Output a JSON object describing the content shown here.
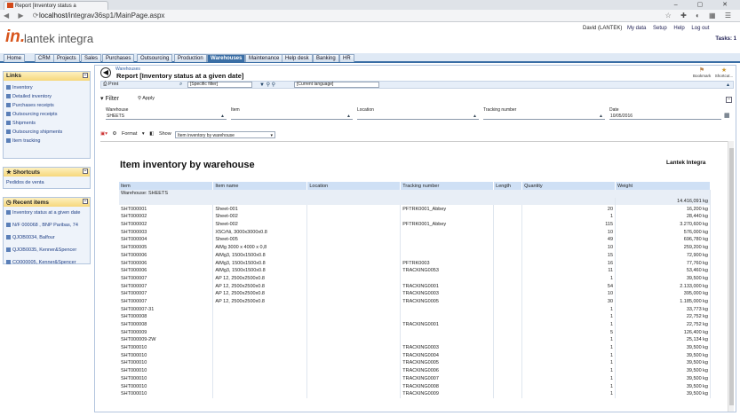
{
  "browser": {
    "tab_title": "Report [Inventory status a",
    "url_host": "localhost",
    "url_path": "/integrav36sp1/MainPage.aspx",
    "nav_glyphs": "◀ ▶ ⟳",
    "url_icons": "☆ ✚ ◐ ▦ ☰"
  },
  "app": {
    "logo_in": "in.",
    "logo_text": "lantek integra",
    "user": "David (LANTEK)",
    "top_links": [
      "My data",
      "Setup",
      "Help",
      "Log out"
    ],
    "tasks": "Tasks: 1"
  },
  "menu": [
    "Home",
    "CRM",
    "Projects",
    "Sales",
    "Purchases",
    "Outsourcing",
    "Production",
    "Warehouses",
    "Maintenance",
    "Help desk",
    "Banking",
    "HR"
  ],
  "menu_active": "Warehouses",
  "sidebar": {
    "links_title": "Links",
    "links": [
      "Inventory",
      "Detailed inventory",
      "Purchases receipts",
      "Outsourcing receipts",
      "Shipments",
      "Outsourcing shipments",
      "Item tracking"
    ],
    "shortcuts_title": "Shortcuts",
    "shortcuts": [
      "Pedidos de venta"
    ],
    "recent_title": "Recent items",
    "recent": [
      "Inventory status at a given date",
      "N/F 000068 , BNP Paribas, 74",
      "QJOB0034, Balfour",
      "QJOB0035, Kenner&Spencer",
      "CO000005, Kenner&Spencer"
    ]
  },
  "page": {
    "breadcrumb": "Warehouses",
    "title": "Report [Inventory status at a given date]",
    "bookmark": "Bookmark",
    "shortcut": "Shortcut...",
    "print": "Print",
    "filter_select": "[Specific filter]",
    "language_select": "[Current language]",
    "filter_label": "Filter",
    "apply_label": "Apply"
  },
  "filters": {
    "warehouse_label": "Warehouse",
    "warehouse_value": "SHEETS",
    "item_label": "Item",
    "item_value": "",
    "location_label": "Location",
    "location_value": "",
    "tracking_label": "Tracking number",
    "tracking_value": "",
    "date_label": "Date",
    "date_value": "10/05/2016"
  },
  "report_tools": {
    "format": "Format",
    "show": "Show",
    "report_select": "Item inventory by warehouse"
  },
  "report": {
    "title": "Item inventory by warehouse",
    "company": "Lantek Integra",
    "columns": [
      "Item",
      "Item name",
      "Location",
      "Tracking number",
      "Length",
      "Quantity",
      "Weight"
    ],
    "warehouse_row": "Warehouse: SHEETS",
    "total_weight": "14.416,091 kg",
    "rows": [
      [
        "SHT000001",
        "Sheet-001",
        "",
        "PFTRK0001_Abbey",
        "",
        "20",
        "16,200 kg"
      ],
      [
        "SHT000002",
        "Sheet-002",
        "",
        "",
        "",
        "1",
        "28,440 kg"
      ],
      [
        "SHT000002",
        "Sheet-002",
        "",
        "PFTRK0001_Abbey",
        "",
        "115",
        "3.270,600 kg"
      ],
      [
        "SHT000003",
        "X5CrNi, 3000x3000x0.8",
        "",
        "",
        "",
        "10",
        "576,000 kg"
      ],
      [
        "SHT000004",
        "Sheet-005",
        "",
        "",
        "",
        "49",
        "696,780 kg"
      ],
      [
        "SHT000005",
        "AlMg 3000 x 4000 x 0,8",
        "",
        "",
        "",
        "10",
        "259,200 kg"
      ],
      [
        "SHT000006",
        "AlMg3, 1500x1500x0.8",
        "",
        "",
        "",
        "15",
        "72,900 kg"
      ],
      [
        "SHT000006",
        "AlMg3, 1500x1500x0.8",
        "",
        "PFTRK0003",
        "",
        "16",
        "77,760 kg"
      ],
      [
        "SHT000006",
        "AlMg3, 1500x1500x0.8",
        "",
        "TRACKING0053",
        "",
        "11",
        "53,460 kg"
      ],
      [
        "SHT000007",
        "AP 12, 2500x2500x0.8",
        "",
        "",
        "",
        "1",
        "39,500 kg"
      ],
      [
        "SHT000007",
        "AP 12, 2500x2500x0.8",
        "",
        "TRACKING0001",
        "",
        "54",
        "2.133,000 kg"
      ],
      [
        "SHT000007",
        "AP 12, 2500x2500x0.8",
        "",
        "TRACKING0003",
        "",
        "10",
        "395,000 kg"
      ],
      [
        "SHT000007",
        "AP 12, 2500x2500x0.8",
        "",
        "TRACKING0005",
        "",
        "30",
        "1.185,000 kg"
      ],
      [
        "SHT000007-31",
        "",
        "",
        "",
        "",
        "1",
        "33,773 kg"
      ],
      [
        "SHT000008",
        "",
        "",
        "",
        "",
        "1",
        "22,752 kg"
      ],
      [
        "SHT000008",
        "",
        "",
        "TRACKING0001",
        "",
        "1",
        "22,752 kg"
      ],
      [
        "SHT000009",
        "",
        "",
        "",
        "",
        "5",
        "126,400 kg"
      ],
      [
        "SHT000009-2W",
        "",
        "",
        "",
        "",
        "1",
        "25,134 kg"
      ],
      [
        "SHT000010",
        "",
        "",
        "TRACKING0003",
        "",
        "1",
        "39,500 kg"
      ],
      [
        "SHT000010",
        "",
        "",
        "TRACKING0004",
        "",
        "1",
        "39,500 kg"
      ],
      [
        "SHT000010",
        "",
        "",
        "TRACKING0005",
        "",
        "1",
        "39,500 kg"
      ],
      [
        "SHT000010",
        "",
        "",
        "TRACKING0006",
        "",
        "1",
        "39,500 kg"
      ],
      [
        "SHT000010",
        "",
        "",
        "TRACKING0007",
        "",
        "1",
        "39,500 kg"
      ],
      [
        "SHT000010",
        "",
        "",
        "TRACKING0008",
        "",
        "1",
        "39,500 kg"
      ],
      [
        "SHT000010",
        "",
        "",
        "TRACKING0009",
        "",
        "1",
        "39,500 kg"
      ]
    ]
  },
  "colors": {
    "accent": "#3a6ea5",
    "logo": "#d8541b",
    "header_cell": "#cfe0f5"
  }
}
